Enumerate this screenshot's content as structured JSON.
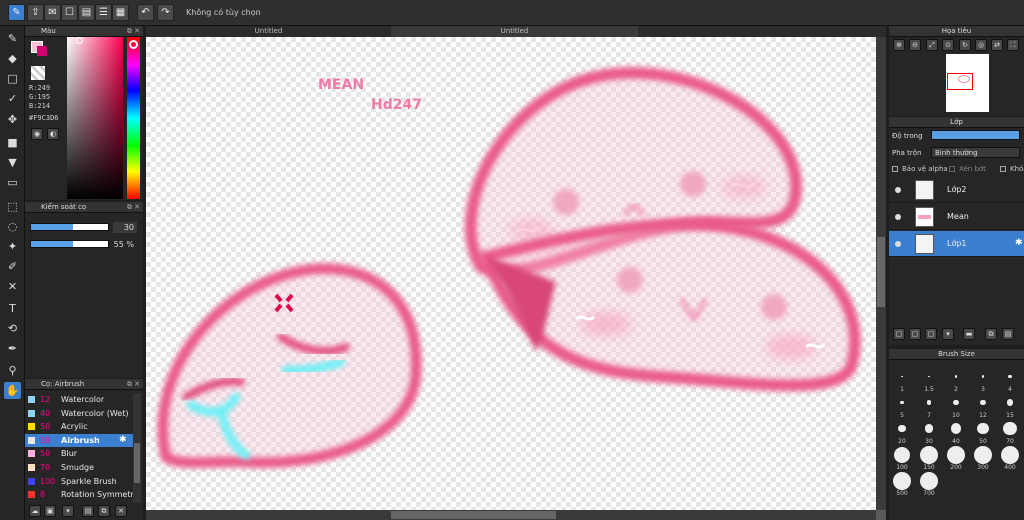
{
  "toolbar": {
    "selection_label": "Không có tùy chọn"
  },
  "tabs": [
    {
      "label": "Untitled"
    },
    {
      "label": "Untitled"
    }
  ],
  "color_panel": {
    "title": "Màu",
    "r": "R:249",
    "g": "G:195",
    "b": "B:214",
    "hex": "#F9C3D6",
    "primary": "#F9C3D6",
    "secondary": "#d0006f"
  },
  "brush_control": {
    "title": "Kiểm soát cọ",
    "size_value": "30",
    "opacity_value": "55 %",
    "size_fraction": 0.55,
    "opacity_fraction": 0.55
  },
  "brush_list": {
    "title": "Cọ: Airbrush",
    "items": [
      {
        "num": "12",
        "name": "Watercolor",
        "color": "#8fd3f0"
      },
      {
        "num": "40",
        "name": "Watercolor (Wet)",
        "color": "#8fd3f0"
      },
      {
        "num": "50",
        "name": "Acrylic",
        "color": "#ffe000"
      },
      {
        "num": "30",
        "name": "Airbrush",
        "color": "#e8e8e8"
      },
      {
        "num": "50",
        "name": "Blur",
        "color": "#ffb0e0"
      },
      {
        "num": "70",
        "name": "Smudge",
        "color": "#ffe0c0"
      },
      {
        "num": "100",
        "name": "Sparkle Brush",
        "color": "#4040ff"
      },
      {
        "num": "8",
        "name": "Rotation Symmetry",
        "color": "#ff3030"
      }
    ]
  },
  "navigator": {
    "title": "Họa tiêu"
  },
  "layers": {
    "title": "Lớp",
    "opacity_label": "Độ trong",
    "blend_label": "Pha trộn",
    "blend_value": "Bình thường",
    "protect_alpha": "Bảo vệ alpha",
    "clipping": "Xén bớt",
    "lock": "Khóa",
    "items": [
      {
        "name": "Lớp2"
      },
      {
        "name": "Mean"
      },
      {
        "name": "Lớp1"
      }
    ]
  },
  "brush_size": {
    "title": "Brush Size",
    "sizes": [
      "1",
      "1.5",
      "2",
      "3",
      "4",
      "5",
      "7",
      "10",
      "12",
      "15",
      "20",
      "30",
      "40",
      "50",
      "70",
      "100",
      "150",
      "200",
      "300",
      "400",
      "500",
      "700"
    ]
  },
  "canvas_text": {
    "line1": "MEAN",
    "line2": "Hd247"
  }
}
